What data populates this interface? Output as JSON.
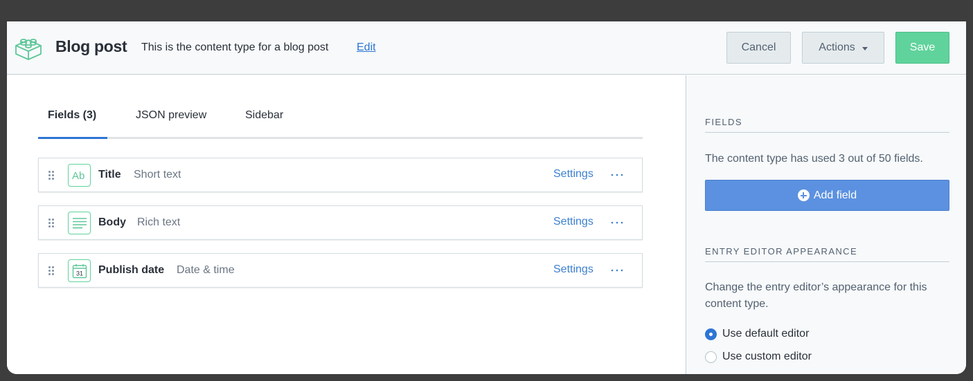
{
  "header": {
    "title": "Blog post",
    "description": "This is the content type for a blog post",
    "edit_label": "Edit",
    "content_type_icon": "lego-brick-icon",
    "buttons": {
      "cancel": "Cancel",
      "actions": "Actions",
      "save": "Save"
    }
  },
  "tabs": [
    {
      "label": "Fields (3)",
      "active": true
    },
    {
      "label": "JSON preview",
      "active": false
    },
    {
      "label": "Sidebar",
      "active": false
    }
  ],
  "fields": [
    {
      "name": "Title",
      "type": "Short text",
      "icon": "short-text-icon",
      "settings_label": "Settings"
    },
    {
      "name": "Body",
      "type": "Rich text",
      "icon": "rich-text-icon",
      "settings_label": "Settings"
    },
    {
      "name": "Publish date",
      "type": "Date & time",
      "icon": "calendar-icon",
      "settings_label": "Settings",
      "icon_text": "31"
    }
  ],
  "sidebar": {
    "fields_heading": "Fields",
    "fields_usage_text": "The content type has used 3 out of 50 fields.",
    "add_field_label": "Add field",
    "appearance_heading": "Entry editor appearance",
    "appearance_text": "Change the entry editor’s appearance for this content type.",
    "editor_options": [
      {
        "label": "Use default editor",
        "selected": true
      },
      {
        "label": "Use custom editor",
        "selected": false
      }
    ]
  },
  "colors": {
    "accent_blue": "#2e75d4",
    "save_green": "#5fd39b",
    "add_field_blue": "#5b91e0"
  }
}
